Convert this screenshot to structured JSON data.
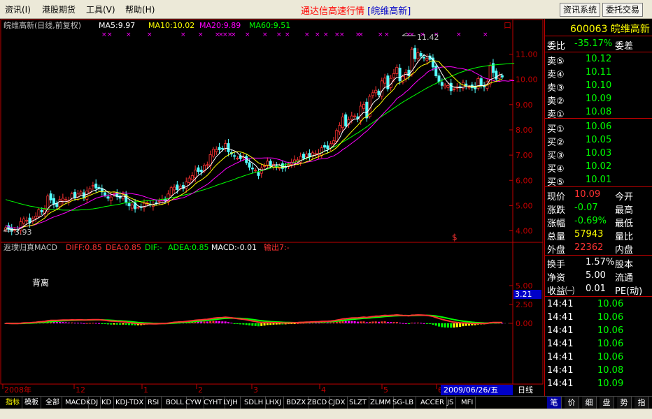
{
  "menu": {
    "items": [
      "资讯(I)",
      "港股期货",
      "工具(V)",
      "帮助(H)"
    ],
    "title_main": "通达信高速行情",
    "title_stock": "[皖维高新]",
    "buttons": [
      "资讯系统",
      "委托交易"
    ]
  },
  "main_chart": {
    "header": {
      "name": "皖维高新(日线,前复权)",
      "ma5": "MA5:9.97",
      "ma10": "MA10:10.02",
      "ma20": "MA20:9.89",
      "ma60": "MA60:9.51"
    },
    "corner_mark": "口",
    "high_label": "11.42",
    "low_label": "3.93",
    "dollar_mark": "$",
    "colors": {
      "ma5": "#ffffff",
      "ma10": "#ffff00",
      "ma20": "#ff00ff",
      "ma60": "#00ff00",
      "up": "#ff3232",
      "down": "#54ffff"
    }
  },
  "macd_chart": {
    "header": {
      "name": "返璞归真MACD",
      "diff": "DIFF:0.85",
      "dea": "DEA:0.85",
      "dif": "DIF:-",
      "adea": "ADEA:0.85",
      "macd": "MACD:-0.01",
      "out": "输出7:-"
    },
    "bei_li": "背离",
    "current_value": "3.21"
  },
  "x_axis": {
    "labels": [
      "2008年",
      "12",
      "1",
      "2",
      "3",
      "4",
      "5",
      "6"
    ],
    "date_box": "2009/06/26/五",
    "period": "日线"
  },
  "chart_data": [
    {
      "type": "candlestick",
      "title": "皖维高新(日线,前复权)",
      "y_ticks": [
        "11.00",
        "10.00",
        "9.00",
        "8.00",
        "7.00",
        "6.00",
        "5.00",
        "4.00"
      ],
      "ylim": [
        3.6,
        11.9
      ],
      "series_names": [
        "MA5:9.97",
        "MA10:10.02",
        "MA20:9.89",
        "MA60:9.51"
      ],
      "close": [
        4.12,
        4.05,
        3.98,
        4.06,
        4.05,
        4.36,
        4.47,
        4.42,
        4.31,
        4.47,
        4.58,
        4.84,
        4.75,
        4.85,
        5.38,
        5.22,
        5.06,
        4.96,
        5.24,
        5.29,
        5.24,
        5.2,
        5.47,
        5.31,
        5.46,
        5.54,
        5.31,
        5.58,
        5.67,
        5.8,
        5.69,
        5.68,
        5.54,
        5.41,
        5.29,
        5.34,
        5.46,
        5.35,
        5.29,
        5.47,
        5.14,
        4.99,
        5.02,
        4.87,
        4.93,
        4.92,
        5.09,
        5.12,
        5.06,
        5.02,
        5.1,
        5.17,
        5.25,
        5.19,
        5.46,
        5.71,
        5.73,
        5.63,
        5.77,
        5.68,
        5.94,
        6.09,
        6.19,
        6.41,
        6.35,
        6.34,
        6.6,
        6.62,
        7.02,
        7.23,
        7.22,
        7.21,
        7.24,
        7.46,
        7.13,
        7.04,
        6.97,
        6.88,
        6.86,
        6.92,
        6.7,
        6.52,
        6.45,
        6.4,
        6.19,
        6.49,
        6.58,
        6.76,
        6.56,
        6.63,
        6.56,
        6.57,
        6.47,
        6.52,
        6.63,
        6.72,
        6.81,
        6.81,
        6.95,
        6.87,
        7.04,
        6.94,
        7.09,
        7.06,
        7.07,
        7.29,
        7.31,
        7.25,
        7.45,
        7.57,
        7.98,
        8.18,
        8.51,
        8.15,
        8.4,
        8.55,
        8.55,
        8.44,
        8.94,
        9.01,
        8.47,
        9.33,
        9.47,
        9.57,
        9.39,
        9.94,
        10.05,
        9.62,
        10.04,
        10.23,
        10.48,
        9.94,
        10.11,
        10.28,
        10.14,
        11.2,
        10.82,
        11.06,
        10.93,
        10.85,
        10.84,
        10.79,
        10.49,
        10.14,
        9.91,
        9.76,
        9.77,
        9.76,
        9.55,
        9.62,
        9.71,
        9.68,
        9.88,
        9.75,
        9.69,
        9.67,
        9.62,
        10.03,
        9.77,
        9.7,
        9.91,
        10.54,
        10.27,
        10.01,
        10.15,
        10.09
      ],
      "ma20": [
        4.21,
        4.16,
        4.12,
        4.12,
        4.11,
        4.14,
        4.17,
        4.18,
        4.2,
        4.22,
        4.25,
        4.3,
        4.34,
        4.38,
        4.44,
        4.5,
        4.55,
        4.59,
        4.63,
        4.68,
        4.72,
        4.78,
        4.83,
        4.89,
        4.95,
        5.0,
        5.05,
        5.1,
        5.17,
        5.23,
        5.29,
        5.33,
        5.36,
        5.39,
        5.4,
        5.43,
        5.45,
        5.48,
        5.48,
        5.5,
        5.5,
        5.49,
        5.47,
        5.45,
        5.43,
        5.4,
        5.36,
        5.32,
        5.28,
        5.25,
        5.23,
        5.2,
        5.19,
        5.18,
        5.19,
        5.21,
        5.24,
        5.26,
        5.29,
        5.31,
        5.36,
        5.42,
        5.48,
        5.55,
        5.63,
        5.7,
        5.77,
        5.84,
        5.93,
        6.04,
        6.14,
        6.24,
        6.33,
        6.44,
        6.52,
        6.58,
        6.64,
        6.7,
        6.75,
        6.81,
        6.85,
        6.87,
        6.89,
        6.88,
        6.88,
        6.88,
        6.89,
        6.89,
        6.89,
        6.88,
        6.85,
        6.82,
        6.78,
        6.73,
        6.71,
        6.69,
        6.68,
        6.67,
        6.68,
        6.69,
        6.72,
        6.74,
        6.76,
        6.8,
        6.84,
        6.85,
        6.86,
        6.88,
        6.93,
        6.97,
        7.04,
        7.12,
        7.22,
        7.29,
        7.38,
        7.47,
        7.56,
        7.65,
        7.75,
        7.86,
        7.95,
        8.07,
        8.19,
        8.32,
        8.45,
        8.58,
        8.71,
        8.83,
        8.96,
        9.09,
        9.24,
        9.32,
        9.4,
        9.51,
        9.6,
        9.73,
        9.85,
        9.96,
        10.06,
        10.15,
        10.27,
        10.35,
        10.4,
        10.44,
        10.46,
        10.49,
        10.49,
        10.5,
        10.5,
        10.48,
        10.45,
        10.44,
        10.42,
        10.39,
        10.36,
        10.33,
        10.26,
        10.2,
        10.13,
        10.06,
        10.03,
        10.0,
        9.96,
        9.92,
        9.92,
        9.94,
        9.94,
        9.93,
        9.95,
        9.95
      ],
      "ma60": [
        5.24,
        5.2,
        5.17,
        5.14,
        5.1,
        5.07,
        5.04,
        5.01,
        4.98,
        4.96,
        4.94,
        4.91,
        4.89,
        4.88,
        4.86,
        4.85,
        4.84,
        4.83,
        4.83,
        4.82,
        4.82,
        4.82,
        4.81,
        4.82,
        4.82,
        4.83,
        4.83,
        4.84,
        4.86,
        4.87,
        4.89,
        4.91,
        4.93,
        4.96,
        4.98,
        5.0,
        5.02,
        5.04,
        5.06,
        5.09,
        5.11,
        5.13,
        5.14,
        5.15,
        5.16,
        5.17,
        5.18,
        5.19,
        5.2,
        5.21,
        5.22,
        5.23,
        5.25,
        5.26,
        5.28,
        5.31,
        5.33,
        5.35,
        5.38,
        5.41,
        5.44,
        5.46,
        5.49,
        5.53,
        5.56,
        5.6,
        5.63,
        5.67,
        5.71,
        5.75,
        5.8,
        5.84,
        5.88,
        5.92,
        5.96,
        6.0,
        6.04,
        6.09,
        6.13,
        6.17,
        6.21,
        6.25,
        6.28,
        6.32,
        6.35,
        6.38,
        6.42,
        6.45,
        6.48,
        6.51,
        6.54,
        6.57,
        6.6,
        6.63,
        6.66,
        6.69,
        6.72,
        6.76,
        6.79,
        6.83,
        6.87,
        6.91,
        6.96,
        7.0,
        7.05,
        7.1,
        7.15,
        7.2,
        7.26,
        7.32,
        7.38,
        7.45,
        7.52,
        7.59,
        7.66,
        7.73,
        7.81,
        7.88,
        7.96,
        8.04,
        8.12,
        8.21,
        8.29,
        8.37,
        8.46,
        8.54,
        8.62,
        8.7,
        8.78,
        8.86,
        8.94,
        9.02,
        9.1,
        9.17,
        9.24,
        9.31,
        9.38,
        9.45,
        9.52,
        9.59,
        9.66,
        9.72,
        9.78,
        9.84,
        9.9,
        9.96,
        10.02,
        10.07,
        10.12,
        10.17,
        10.22,
        10.27,
        10.31,
        10.35,
        10.39,
        10.42,
        10.45,
        10.48,
        10.5,
        10.52,
        10.54,
        10.56,
        10.57,
        10.58,
        10.59,
        10.6,
        10.61,
        10.62,
        10.63,
        10.64
      ]
    },
    {
      "type": "bar",
      "title": "返璞归真MACD",
      "y_ticks": [
        "5.00",
        "2.50",
        "0.00"
      ],
      "ylim": [
        -5,
        10
      ]
    }
  ],
  "quote_panel": {
    "code_name": "600063 皖维高新",
    "weibi_label": "委比",
    "weibi_value": "-35.17%",
    "weicha_label": "委差",
    "sells": [
      {
        "label": "卖⑤",
        "price": "10.12"
      },
      {
        "label": "卖④",
        "price": "10.11"
      },
      {
        "label": "卖③",
        "price": "10.10"
      },
      {
        "label": "卖②",
        "price": "10.09"
      },
      {
        "label": "卖①",
        "price": "10.08"
      }
    ],
    "buys": [
      {
        "label": "买①",
        "price": "10.06"
      },
      {
        "label": "买②",
        "price": "10.05"
      },
      {
        "label": "买③",
        "price": "10.03"
      },
      {
        "label": "买④",
        "price": "10.02"
      },
      {
        "label": "买⑤",
        "price": "10.01"
      }
    ],
    "stats": [
      {
        "label": "现价",
        "value": "10.09",
        "label2": "今开",
        "color": "#ff3232"
      },
      {
        "label": "涨跌",
        "value": "-0.07",
        "label2": "最高",
        "color": "#00ff00"
      },
      {
        "label": "涨幅",
        "value": "-0.69%",
        "label2": "最低",
        "color": "#00ff00"
      },
      {
        "label": "总量",
        "value": "57943",
        "label2": "量比",
        "color": "#ffff00"
      },
      {
        "label": "外盘",
        "value": "22362",
        "label2": "内盘",
        "color": "#ff3232"
      }
    ],
    "stats2": [
      {
        "label": "换手",
        "value": "1.57%",
        "label2": "股本"
      },
      {
        "label": "净资",
        "value": "5.00",
        "label2": "流通"
      },
      {
        "label": "收益㈠",
        "value": "0.01",
        "label2": "PE(动)"
      }
    ],
    "ticks": [
      {
        "time": "14:41",
        "price": "10.06"
      },
      {
        "time": "14:41",
        "price": "10.06"
      },
      {
        "time": "14:41",
        "price": "10.06"
      },
      {
        "time": "14:41",
        "price": "10.06"
      },
      {
        "time": "14:41",
        "price": "10.06"
      },
      {
        "time": "14:41",
        "price": "10.08"
      },
      {
        "time": "14:41",
        "price": "10.09"
      }
    ]
  },
  "bottom_tabs": [
    "指标",
    "模板",
    "全部",
    "MACD",
    "KDJ",
    "KD",
    "KDJ-TDX",
    "RSI",
    "BOLL",
    "CYW",
    "CYHT",
    "LYJH",
    "SDLH",
    "LHXJ",
    "BDZX",
    "ZBCD",
    "CJDX",
    "SLZT",
    "ZLMM",
    "SG-LB",
    "ACCER",
    "JS",
    "MFI"
  ],
  "right_tabs": [
    "笔",
    "价",
    "细",
    "盘",
    "势",
    "指"
  ]
}
